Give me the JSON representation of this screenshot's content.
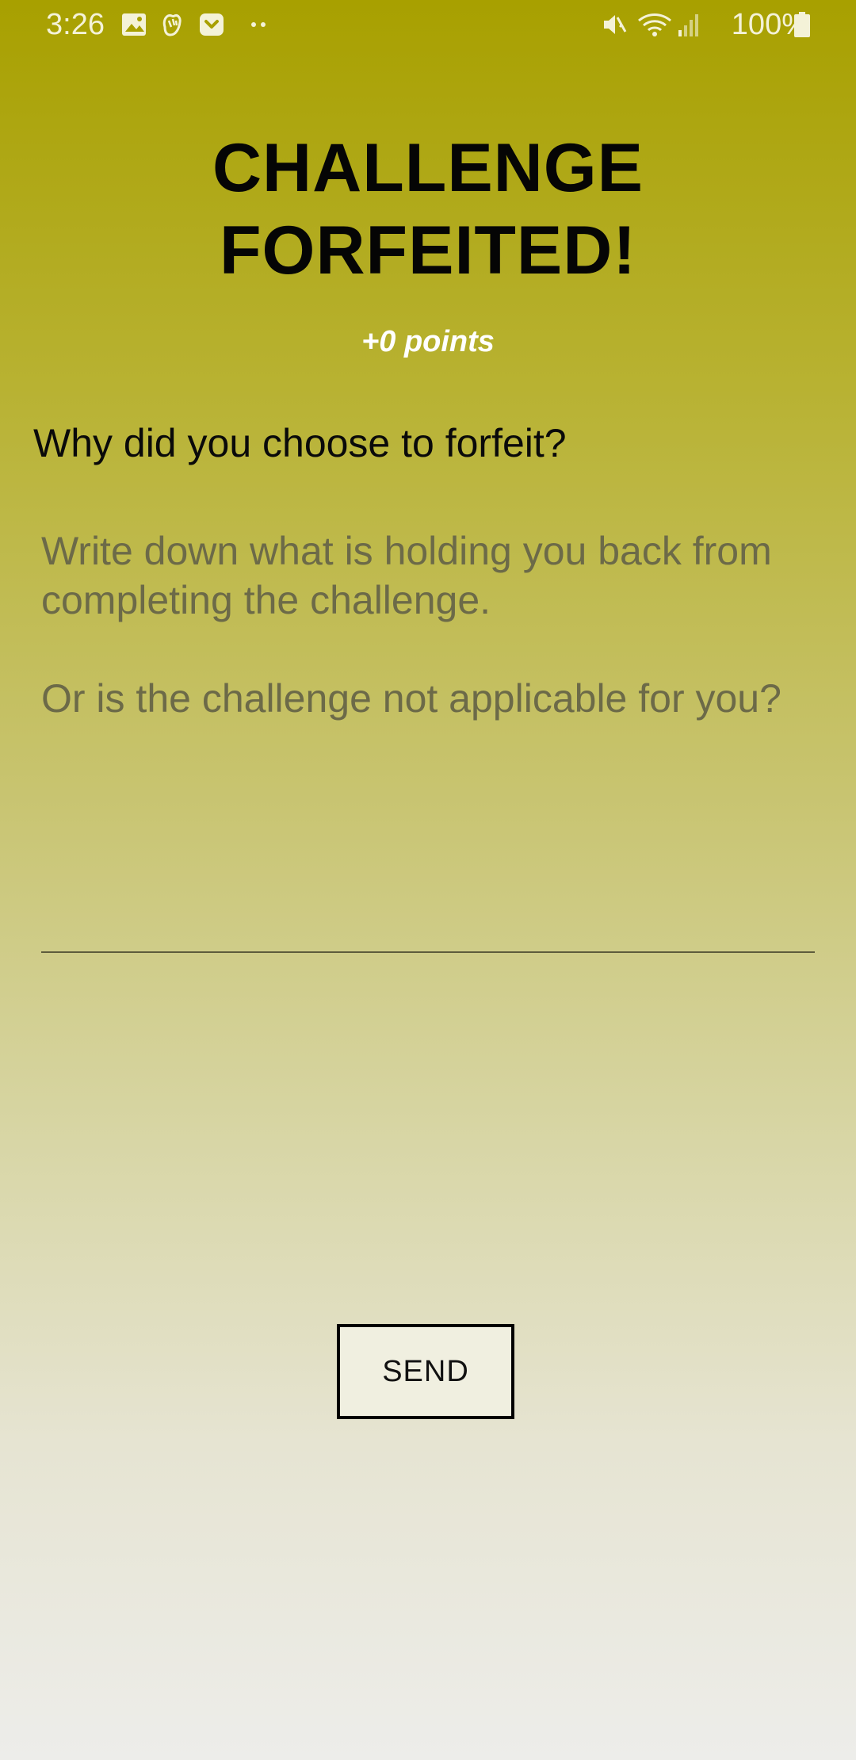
{
  "status_bar": {
    "time": "3:26",
    "battery": "100%",
    "left_icons": [
      "gallery-icon",
      "hand-icon",
      "pocket-icon",
      "more-dots-icon"
    ],
    "right_icons": [
      "mute-icon",
      "wifi-icon",
      "signal-icon",
      "battery-icon"
    ]
  },
  "screen": {
    "title_line1": "CHALLENGE",
    "title_line2": "FORFEITED!",
    "points": "+0 points",
    "question": "Why did you choose to forfeit?",
    "answer_placeholder": "Write down what is holding you back from completing the challenge.\n\nOr is the challenge not applicable for you?",
    "answer_value": "",
    "send_label": "SEND"
  },
  "colors": {
    "gradient_top": "#a8a000",
    "gradient_bottom": "#ededea",
    "points_text": "#ffffff",
    "placeholder_text": "#6c6a48",
    "button_bg": "#f0efe0"
  }
}
